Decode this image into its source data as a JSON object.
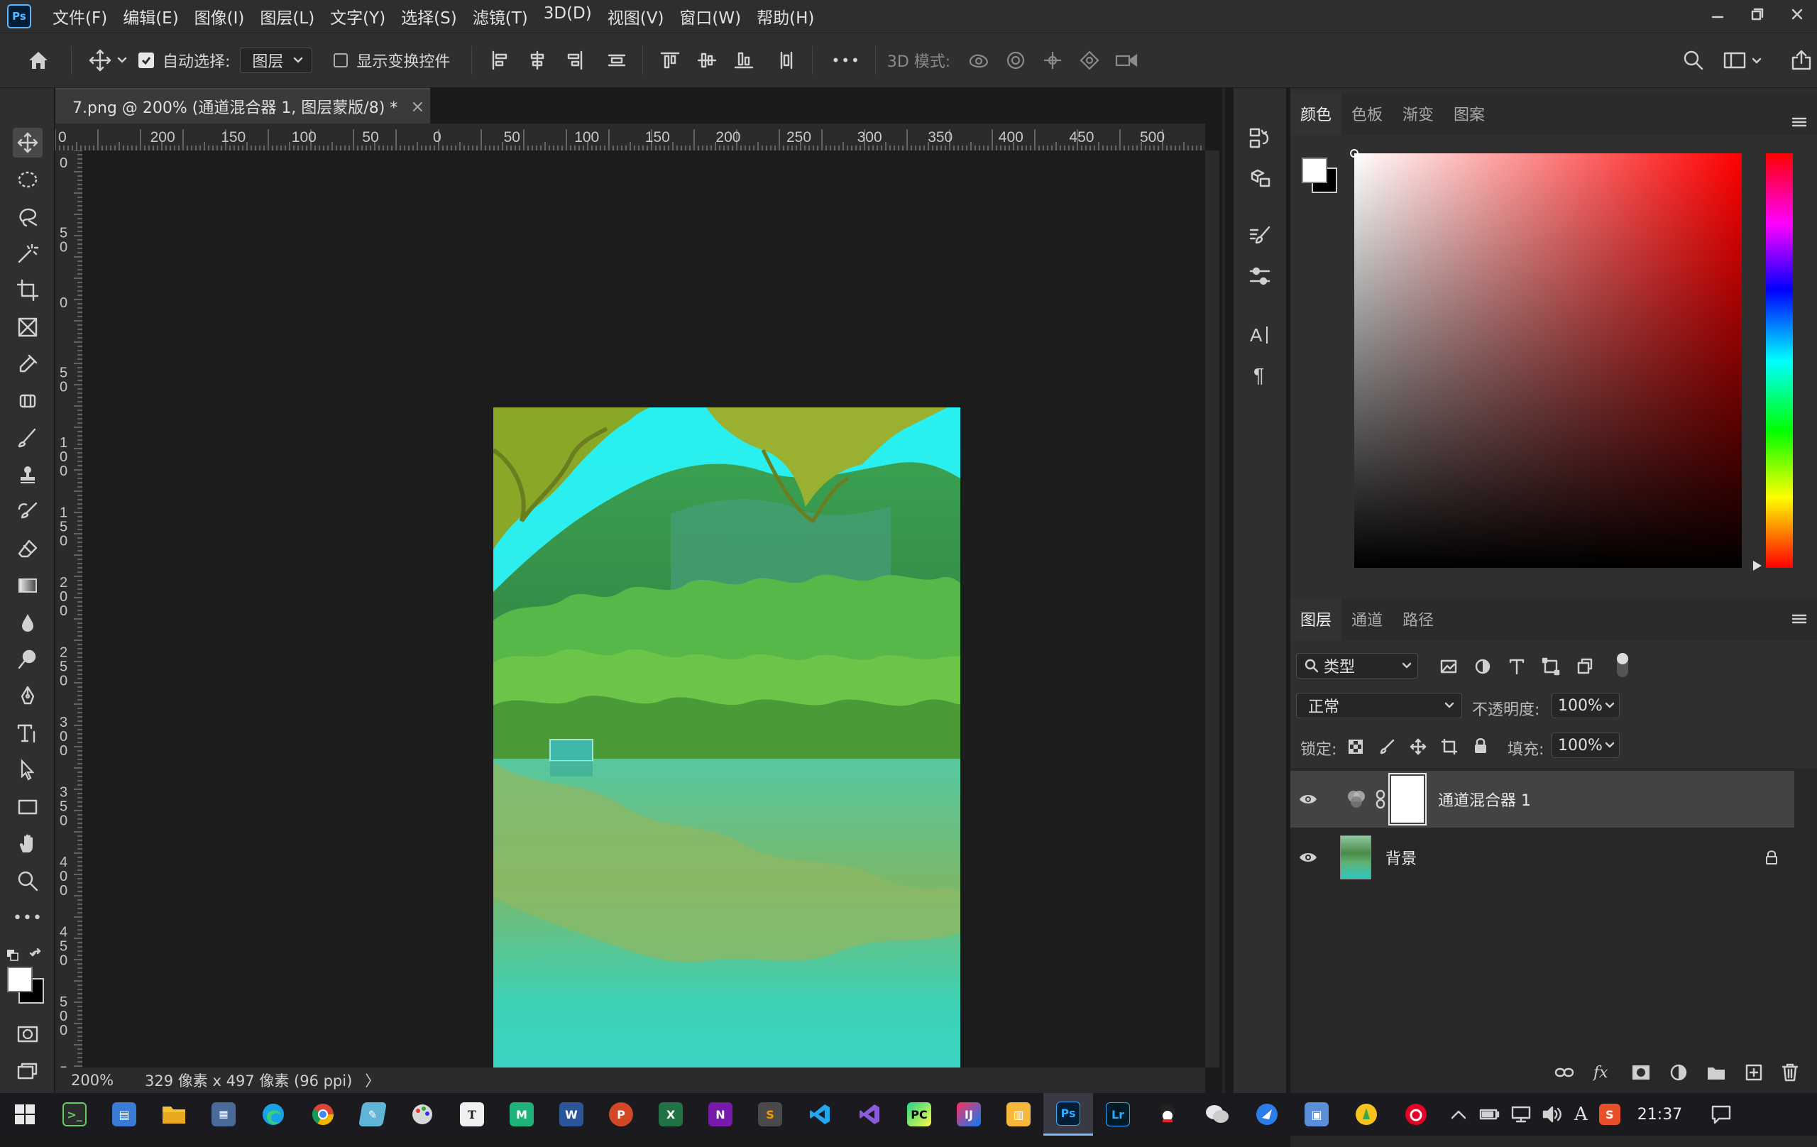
{
  "app": {
    "logo": "Ps"
  },
  "menu": [
    "文件(F)",
    "编辑(E)",
    "图像(I)",
    "图层(L)",
    "文字(Y)",
    "选择(S)",
    "滤镜(T)",
    "3D(D)",
    "视图(V)",
    "窗口(W)",
    "帮助(H)"
  ],
  "options": {
    "auto_select_label": "自动选择:",
    "auto_select_checked": true,
    "auto_select_target": "图层",
    "show_transform_label": "显示变换控件",
    "show_transform_checked": false,
    "more": "•••",
    "mode_3d_label": "3D 模式:"
  },
  "document": {
    "tab_title": "7.png @ 200% (通道混合器 1, 图层蒙版/8) *",
    "close": "×",
    "zoom": "200%",
    "size_info": "329 像素 x 497 像素 (96 ppi)",
    "arrow": "〉"
  },
  "ruler": {
    "h_labels": [
      "0",
      "200",
      "150",
      "100",
      "50",
      "0",
      "50",
      "100",
      "150",
      "200",
      "250",
      "300",
      "350",
      "400",
      "450",
      "500",
      "5"
    ],
    "v_labels": [
      "0",
      "5 0",
      "0",
      "5 0",
      "1 0 0",
      "1 5 0",
      "2 0 0",
      "2 5 0",
      "3 0 0",
      "3 5 0",
      "4 0 0",
      "4 5 0",
      "5 0 0",
      "5"
    ]
  },
  "color_panel": {
    "tabs": [
      "颜色",
      "色板",
      "渐变",
      "图案"
    ],
    "active_tab": 0,
    "foreground": "#ffffff",
    "background": "#000000",
    "hue_color": "#ff0000"
  },
  "layers_panel": {
    "tabs": [
      "图层",
      "通道",
      "路径"
    ],
    "active_tab": 0,
    "filter_kind": "类型",
    "blend_mode": "正常",
    "opacity_label": "不透明度:",
    "opacity": "100%",
    "lock_label": "锁定:",
    "fill_label": "填充:",
    "fill": "100%",
    "layers": [
      {
        "name": "通道混合器 1",
        "visible": true,
        "selected": true,
        "type": "adjustment"
      },
      {
        "name": "背景",
        "visible": true,
        "selected": false,
        "type": "background",
        "locked": true
      }
    ]
  },
  "taskbar": {
    "time": "21:37",
    "ime": "A"
  }
}
